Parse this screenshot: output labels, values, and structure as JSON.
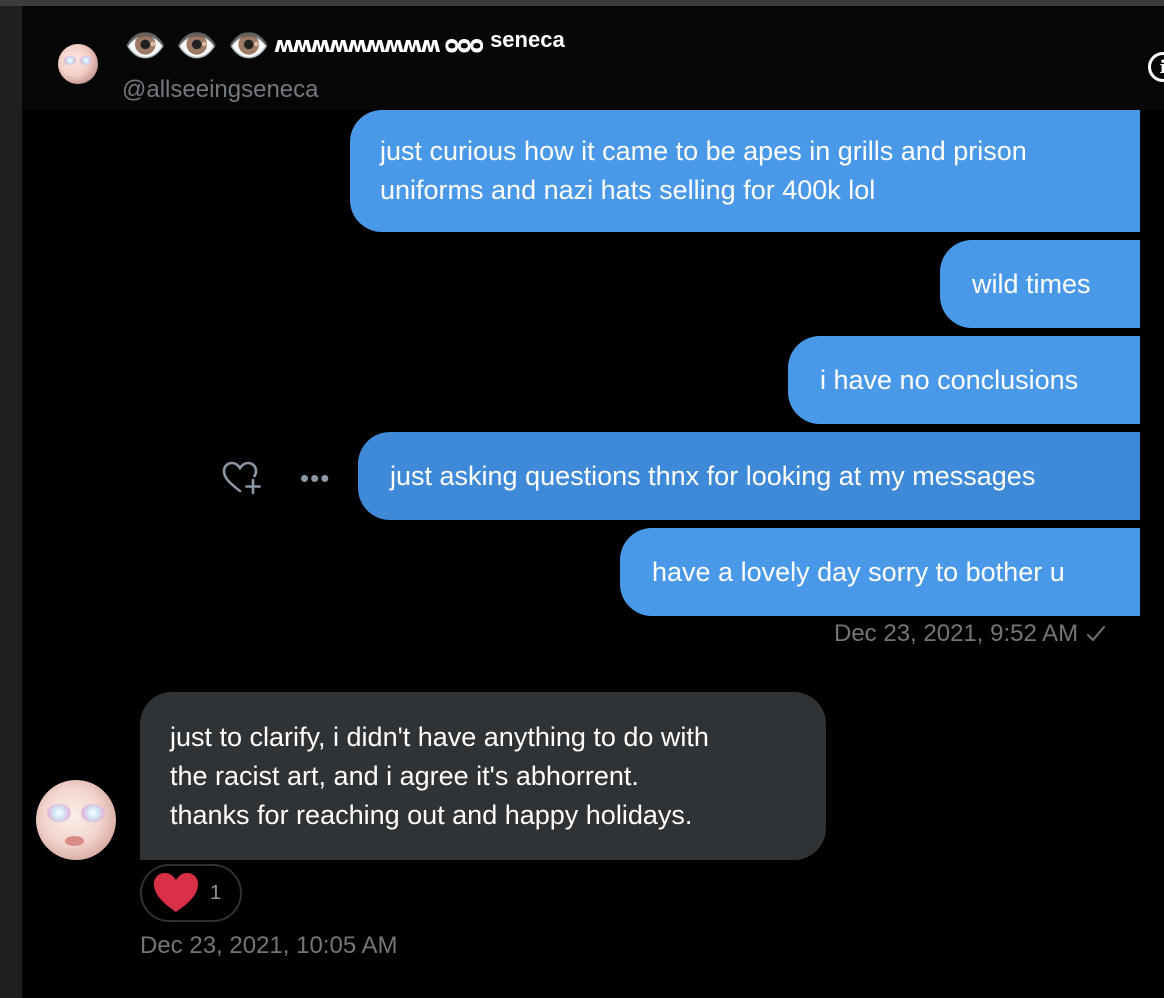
{
  "header": {
    "display_name_emoji": "👁️ 👁️ 👁️",
    "display_name_squiggle": "ʍʍʍʍʍʍʍʍʍ ᴑᴑᴑ",
    "display_name_word": "seneca",
    "handle": "@allseeingseneca",
    "info_icon": "info-icon"
  },
  "messages": {
    "outgoing": [
      {
        "text": "just curious how it came to be apes in grills and prison\nuniforms and nazi hats selling for 400k lol"
      },
      {
        "text": "wild times"
      },
      {
        "text": "i have no conclusions"
      },
      {
        "text": "just asking questions thnx for looking at my messages"
      },
      {
        "text": "have a lovely day sorry to bother u"
      }
    ],
    "outgoing_timestamp": "Dec 23, 2021, 9:52 AM",
    "incoming": [
      {
        "text": "just to clarify, i didn't have anything to do with\nthe racist art, and i agree it's abhorrent.\nthanks for reaching out and happy holidays."
      }
    ],
    "incoming_reaction_count": "1",
    "incoming_timestamp": "Dec 23, 2021, 10:05 AM"
  },
  "icons": [
    "heart-plus-icon",
    "more-icon",
    "check-icon",
    "heart-icon",
    "info-icon"
  ],
  "colors": {
    "outgoing_bubble": "#4a99e9",
    "incoming_bubble": "#2f3336",
    "background": "#000000",
    "muted_text": "#71767b",
    "reaction_heart": "#e0245e"
  }
}
